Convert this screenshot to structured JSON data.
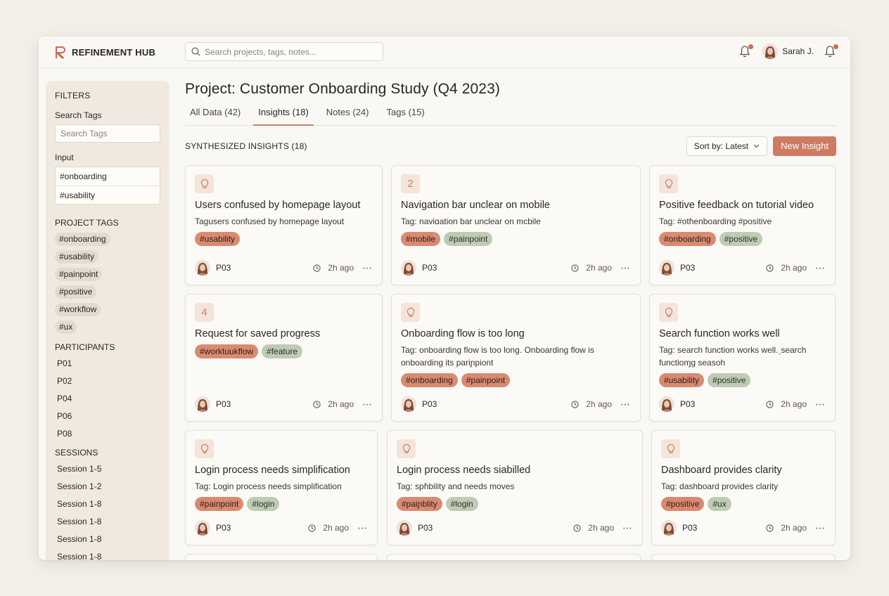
{
  "app": {
    "name": "REFINEMENT HUB"
  },
  "search": {
    "placeholder": "Search projects, tags, notes..."
  },
  "user": {
    "name": "Sarah J."
  },
  "sidebar": {
    "filters_title": "FILTERS",
    "search_tags_label": "Search Tags",
    "search_tags_placeholder": "Search Tags",
    "input_label": "Input",
    "input_values": [
      "#onboarding",
      "#usability"
    ],
    "project_tags_title": "PROJECT TAGS",
    "project_tags": [
      "#onboarding",
      "#usability",
      "#painpoint",
      "#positive",
      "#workflow",
      "#ux"
    ],
    "participants_title": "PARTICIPANTS",
    "participants": [
      "P01",
      "P02",
      "P04",
      "P06",
      "P08"
    ],
    "sessions_title": "SESSIONS",
    "sessions": [
      "Session 1-5",
      "Session 1-2",
      "Session 1-8",
      "Session 1-8",
      "Session 1-8",
      "Session 1-8"
    ]
  },
  "main": {
    "title": "Project: Customer Onboarding Study (Q4 2023)",
    "tabs": [
      "All Data (42)",
      "Insights (18)",
      "Notes (24)",
      "Tags (15)"
    ],
    "section_title": "SYNTHESIZED INSIGHTS (18)",
    "sort_label": "Sort by: Latest",
    "new_button": "New Insight"
  },
  "cards": [
    {
      "icon": "lightbulb-icon",
      "title": "Users confused by homepage layout",
      "desc": "Tagusers confused by homepage layout",
      "tags": [
        {
          "t": "#usability",
          "c": "red"
        }
      ],
      "pid": "P03",
      "time": "2h ago"
    },
    {
      "icon": "2",
      "title": "Navigation bar unclear on mobile",
      "desc": "Tag: naviɑation bar unclear on mcbile",
      "tags": [
        {
          "t": "#mobile",
          "c": "red"
        },
        {
          "t": "#painpoint",
          "c": "green"
        }
      ],
      "pid": "P03",
      "time": "2h ago"
    },
    {
      "icon": "lightbulb-icon",
      "title": "Positive feedback on tutorial video",
      "desc": "Tag: #otɦenboarding #positive",
      "tags": [
        {
          "t": "#onboarding",
          "c": "red"
        },
        {
          "t": "#positive",
          "c": "green"
        }
      ],
      "pid": "P03",
      "time": "2h ago"
    },
    {
      "icon": "4",
      "title": "Request for saved progress",
      "desc": "",
      "tags": [
        {
          "t": "#worktuukflow",
          "c": "red"
        },
        {
          "t": "#feature",
          "c": "green"
        }
      ],
      "pid": "P03",
      "time": "2h ago"
    },
    {
      "icon": "lightbulb-icon",
      "title": "Onboarding flow is too long",
      "desc": "Tag: onboarding flow is too long. Onboarding flow is onboarding its pariɲpiont",
      "tags": [
        {
          "t": "#onboarding",
          "c": "red"
        },
        {
          "t": "#painpoint",
          "c": "red"
        }
      ],
      "pid": "P03",
      "time": "2h ago"
    },
    {
      "icon": "lightbulb-icon",
      "title": "Search function works well",
      "desc": "Tag: search function works well.ˏsearch functioɱg seasoh",
      "tags": [
        {
          "t": "#usability",
          "c": "red"
        },
        {
          "t": "#positive",
          "c": "green"
        }
      ],
      "pid": "P03",
      "time": "2h ago"
    },
    {
      "icon": "lightbulb-icon",
      "title": "Login process needs simplification",
      "desc": "Tag: Login process needs simplification",
      "tags": [
        {
          "t": "#painpoint",
          "c": "red"
        },
        {
          "t": "#login",
          "c": "green"
        }
      ],
      "pid": "P03",
      "time": "2h ago"
    },
    {
      "icon": "lightbulb-icon",
      "title": "Login process needs siabilled",
      "desc": "Tag: spɦbility and needs moves",
      "tags": [
        {
          "t": "#paiɲblity",
          "c": "red"
        },
        {
          "t": "#login",
          "c": "green"
        }
      ],
      "pid": "P03",
      "time": "2h ago"
    },
    {
      "icon": "lightbulb-icon",
      "title": "Dashboard provides clarity",
      "desc": "Tag: dashboard provides clarity",
      "tags": [
        {
          "t": "#positive",
          "c": "red"
        },
        {
          "t": "#ux",
          "c": "green"
        }
      ],
      "pid": "P03",
      "time": "2h ago"
    }
  ],
  "colors": {
    "accent": "#cf7a62",
    "tag_red": "#d98a71",
    "tag_green": "#bfcbb4",
    "background": "#f3f0ea"
  }
}
